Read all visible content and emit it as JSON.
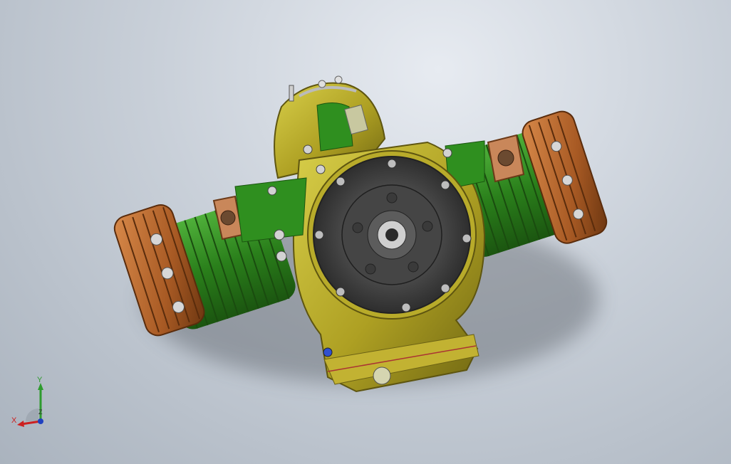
{
  "scene": {
    "title": "",
    "background_top": "#e7ebf1",
    "background_bottom": "#aab3be"
  },
  "model": {
    "name": "boxer-engine-assembly",
    "colors": {
      "cylinder_green": "#2f8f1f",
      "crankcase_yellow": "#b8ab2a",
      "cylinder_head_copper": "#b8662c",
      "flywheel_gray": "#4d4d4d",
      "gasket_tan": "#c9875a"
    }
  },
  "triad": {
    "x_label": "X",
    "y_label": "Y",
    "z_label": "Z",
    "x_color": "#cc2020",
    "y_color": "#2e9b2e",
    "z_color": "#2040c0"
  }
}
